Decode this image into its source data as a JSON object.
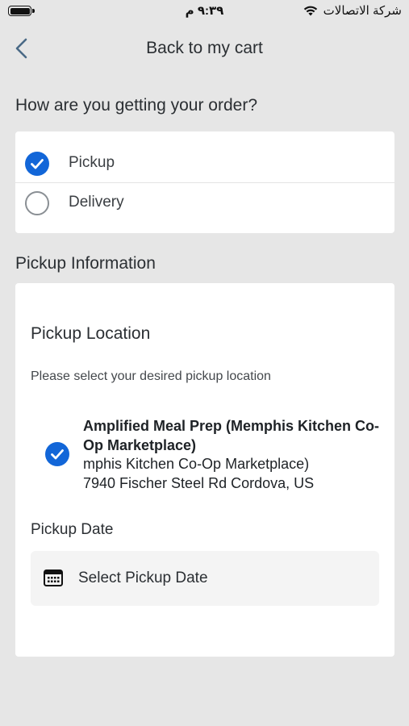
{
  "status_bar": {
    "time": "٩:٣٩ م",
    "carrier": "شركة الاتصالات",
    "wifi_icon": "wifi-icon",
    "battery_icon": "battery-icon"
  },
  "header": {
    "back_icon": "chevron-left-icon",
    "title": "Back to my cart"
  },
  "order_method": {
    "title": "How are you getting your order?",
    "options": [
      {
        "label": "Pickup",
        "selected": true
      },
      {
        "label": "Delivery",
        "selected": false
      }
    ]
  },
  "pickup_info": {
    "title": "Pickup Information",
    "location_title": "Pickup Location",
    "hint": "Please select your desired pickup location",
    "location": {
      "name": "Amplified Meal Prep (Memphis Kitchen Co-Op Marketplace)",
      "address_line1": "mphis Kitchen Co-Op Marketplace)",
      "address_line2": "7940 Fischer Steel Rd Cordova, US",
      "selected": true
    },
    "date_title": "Pickup Date",
    "date_placeholder": "Select Pickup Date",
    "date_icon": "calendar-icon"
  },
  "colors": {
    "accent": "#1266d8",
    "background": "#e6e6e6",
    "card": "#ffffff"
  }
}
